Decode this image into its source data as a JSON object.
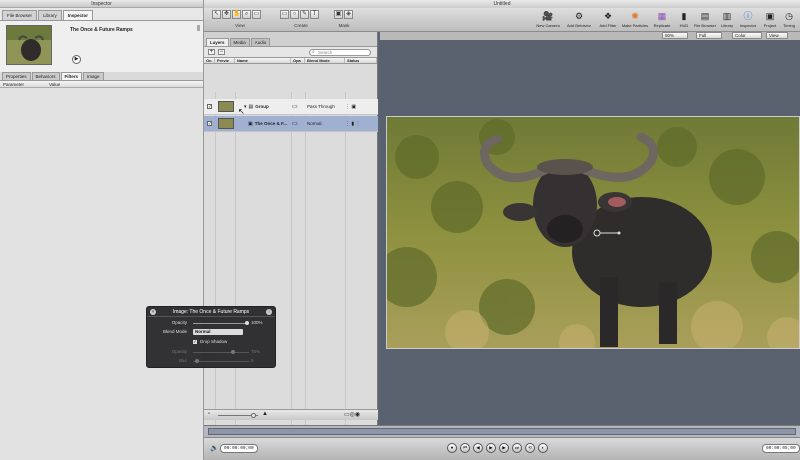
{
  "inspector": {
    "window_title": "Inspector",
    "top_tabs": [
      "File Browser",
      "Library",
      "Inspector"
    ],
    "preview_title": "The Once & Future Ramps",
    "sub_tabs": [
      "Properties",
      "Behaviors",
      "Filters",
      "Image"
    ],
    "columns": [
      "Parameter",
      "Value"
    ]
  },
  "main": {
    "window_title": "Untitled",
    "toolbar": {
      "group_labels": [
        "View",
        "Create",
        "Mask"
      ],
      "right_items": [
        "New Camera",
        "Add Behavior",
        "Add Filter",
        "Make Particles",
        "Replicate",
        "HUD",
        "File Browser",
        "Library",
        "Inspector",
        "Project",
        "Timing"
      ]
    },
    "viewer_controls": [
      "50%",
      "Full",
      "Color",
      "View"
    ]
  },
  "layers": {
    "tabs": [
      "Layers",
      "Media",
      "Audio"
    ],
    "search_placeholder": "Search",
    "columns": [
      "On",
      "Previe",
      "Name",
      "Opa",
      "Blend Mode",
      "Status"
    ],
    "rows": [
      {
        "name": "Group",
        "blend": "Pass Through"
      },
      {
        "name": "The Once & F...",
        "blend": "Normal"
      }
    ]
  },
  "transport": {
    "timecode_left": "00:00:00;00",
    "timecode_right": "00:00:05;00"
  },
  "hud": {
    "title": "Image: The Once & Future Ramps",
    "opacity_label": "Opacity",
    "opacity_value": "100%",
    "blend_label": "Blend Mode",
    "blend_value": "Normal",
    "drop_shadow_label": "Drop Shadow",
    "shadow_opacity_label": "Opacity",
    "shadow_opacity_value": "75%",
    "blur_label": "Blur",
    "blur_value": "5"
  }
}
